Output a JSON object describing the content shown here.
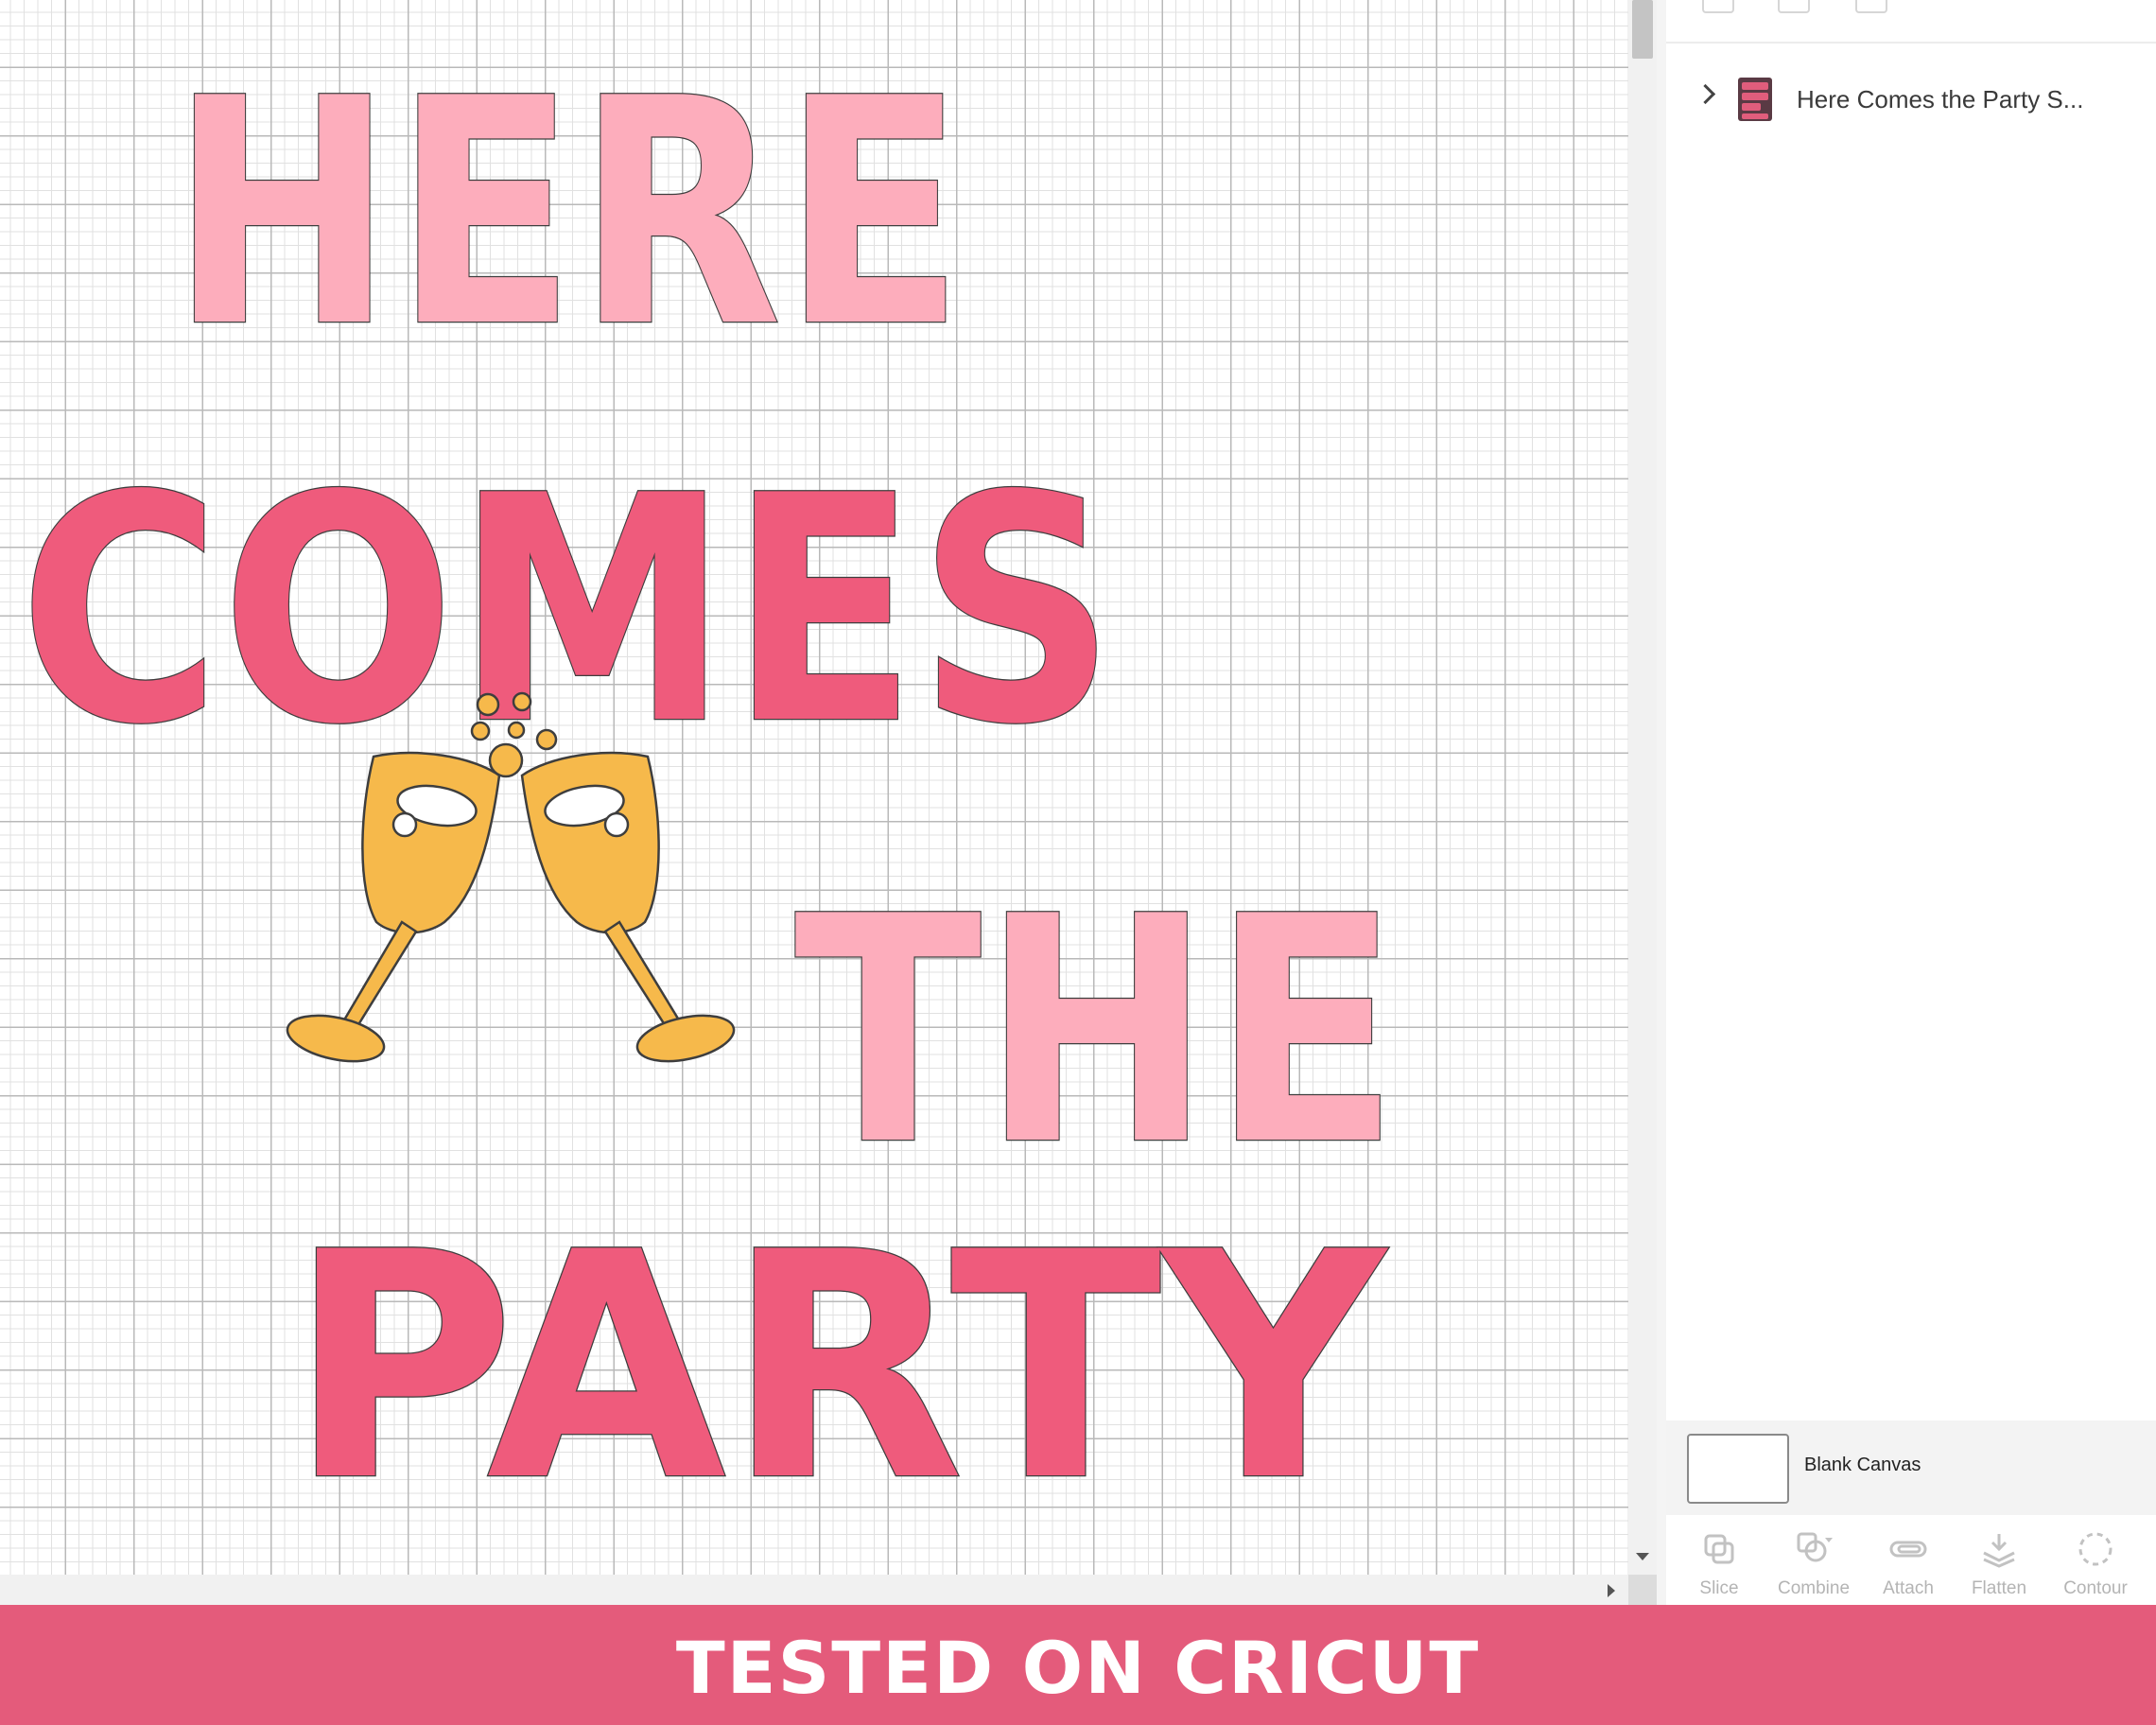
{
  "design": {
    "lines": [
      {
        "text": "HERE",
        "color": "#fdadbc"
      },
      {
        "text": "COMES",
        "color": "#ef5b7c"
      },
      {
        "text": "THE",
        "color": "#fdadbc"
      },
      {
        "text": "PARTY",
        "color": "#ef5b7c"
      }
    ],
    "glass_color": "#f6b94b",
    "outline_color": "#3e3e3e"
  },
  "layers_panel": {
    "layer_name": "Here Comes the Party S...",
    "blank_canvas_label": "Blank Canvas"
  },
  "tools": [
    {
      "label": "Slice",
      "icon": "slice-icon"
    },
    {
      "label": "Combine",
      "icon": "combine-icon"
    },
    {
      "label": "Attach",
      "icon": "attach-icon"
    },
    {
      "label": "Flatten",
      "icon": "flatten-icon"
    },
    {
      "label": "Contour",
      "icon": "contour-icon"
    }
  ],
  "banner": {
    "text": "TESTED ON CRICUT",
    "color": "#e45b7b"
  }
}
